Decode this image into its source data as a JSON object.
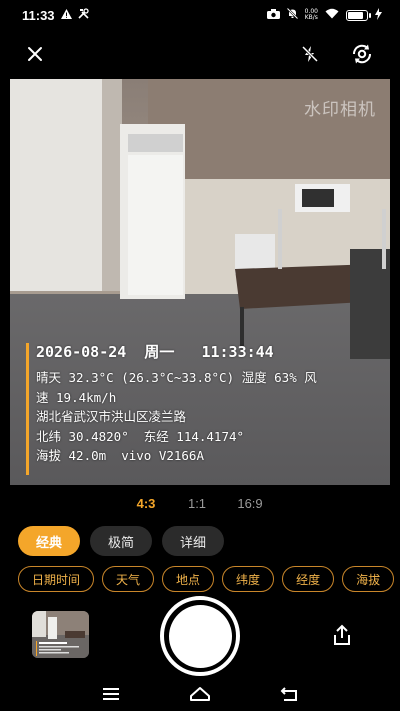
{
  "status_bar": {
    "time": "11:33",
    "net_speed_value": "0.00",
    "net_speed_unit": "KB/s",
    "battery_level_pct": 90
  },
  "toolbar": {
    "icons": [
      "close-icon",
      "flash-off-icon",
      "flip-camera-icon"
    ]
  },
  "watermark_app": "水印相机",
  "overlay": {
    "datetime": "2026-08-24  周一   11:33:44",
    "weather_line1": "晴天 32.3°C (26.3°C~33.8°C) 湿度 63% 风",
    "weather_line2": "速 19.4km/h",
    "address": "湖北省武汉市洪山区凌兰路",
    "coords": "北纬 30.4820°  东经 114.4174°",
    "altitude": "海拔 42.0m  vivo V2166A"
  },
  "ratios": [
    {
      "label": "4:3",
      "active": true
    },
    {
      "label": "1:1",
      "active": false
    },
    {
      "label": "16:9",
      "active": false
    }
  ],
  "templates": [
    {
      "label": "经典",
      "active": true
    },
    {
      "label": "极简",
      "active": false
    },
    {
      "label": "详细",
      "active": false
    }
  ],
  "fields": [
    "日期时间",
    "天气",
    "地点",
    "纬度",
    "经度",
    "海拔"
  ],
  "colors": {
    "accent": "#f4a62a",
    "chip_bg": "#2b2b2b",
    "background": "#000000"
  }
}
